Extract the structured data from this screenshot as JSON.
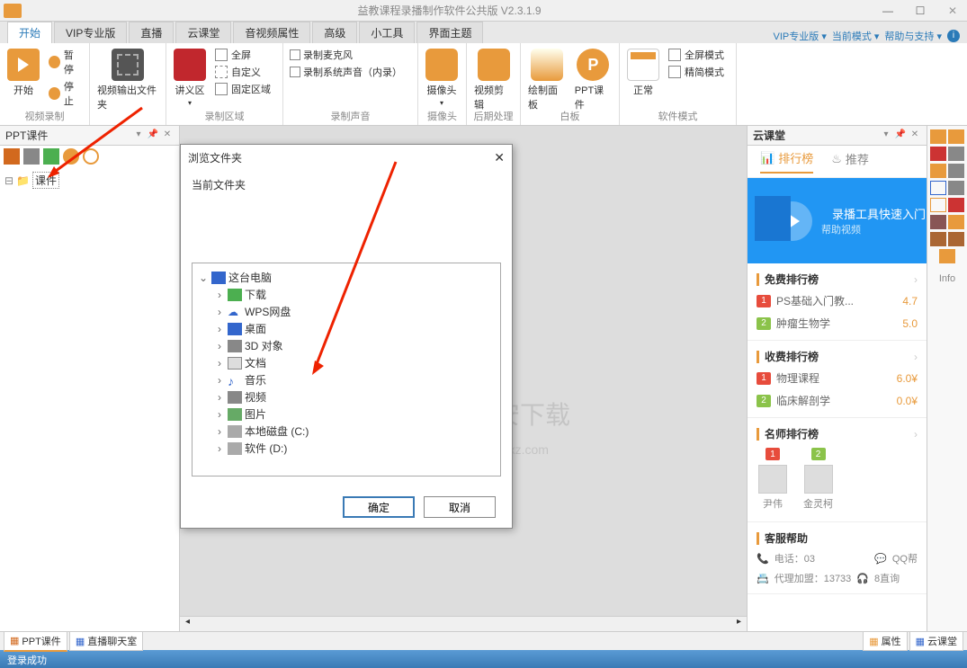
{
  "title": "益教课程录播制作软件公共版 V2.3.1.9",
  "tabs": {
    "start": "开始",
    "vip": "VIP专业版",
    "live": "直播",
    "cloud": "云课堂",
    "av": "音视频属性",
    "adv": "高级",
    "tools": "小工具",
    "theme": "界面主题"
  },
  "topright": {
    "vip": "VIP专业版 ▾",
    "mode": "当前模式 ▾",
    "help": "帮助与支持 ▾"
  },
  "ribbon": {
    "g1": {
      "label": "视频录制",
      "start": "开始",
      "pause": "暂停",
      "stop": "停止",
      "out": "视频输出文件夹"
    },
    "g2": {
      "label": "录制区域",
      "area": "讲义区",
      "full": "全屏",
      "custom": "自定义",
      "fixed": "固定区域"
    },
    "g3": {
      "label": "录制声音",
      "mic": "录制麦克风",
      "sys": "录制系统声音（内录）"
    },
    "g4": {
      "label": "摄像头",
      "cam": "摄像头"
    },
    "g5": {
      "label": "后期处理",
      "clip": "视频剪辑"
    },
    "g6": {
      "label": "白板",
      "draw": "绘制面板",
      "ppt": "PPT课件"
    },
    "g7": {
      "label": "软件模式",
      "normal": "正常",
      "fullscreen": "全屏模式",
      "lite": "精简模式"
    }
  },
  "left": {
    "title": "PPT课件",
    "root": "课件"
  },
  "rightp": {
    "title": "云课堂",
    "tab1": "排行榜",
    "tab2": "推荐",
    "promo1": "录播工具快速入门",
    "promo2": "帮助视频",
    "s1": "免费排行榜",
    "s1i1": "PS基础入门教...",
    "s1v1": "4.7",
    "s1i2": "肿瘤生物学",
    "s1v2": "5.0",
    "s2": "收费排行榜",
    "s2i1": "物理课程",
    "s2v1": "6.0¥",
    "s2i2": "临床解剖学",
    "s2v2": "0.0¥",
    "s3": "名师排行榜",
    "n1": "尹伟",
    "n2": "金灵柯",
    "s4": "客服帮助",
    "c1": "电话：03",
    "c2": "QQ帮",
    "c3": "代理加盟：13733",
    "c4": "8直询"
  },
  "btabs": {
    "ppt": "PPT课件",
    "chat": "直播聊天室",
    "prop": "属性",
    "cloud": "云课堂"
  },
  "status": "登录成功",
  "dialog": {
    "title": "浏览文件夹",
    "current": "当前文件夹",
    "ok": "确定",
    "cancel": "取消",
    "pc": "这台电脑",
    "dl": "下载",
    "wps": "WPS网盘",
    "desk": "桌面",
    "d3": "3D 对象",
    "doc": "文档",
    "music": "音乐",
    "video": "视频",
    "pic": "图片",
    "diskc": "本地磁盘 (C:)",
    "diskd": "软件 (D:)"
  },
  "info": "Info"
}
